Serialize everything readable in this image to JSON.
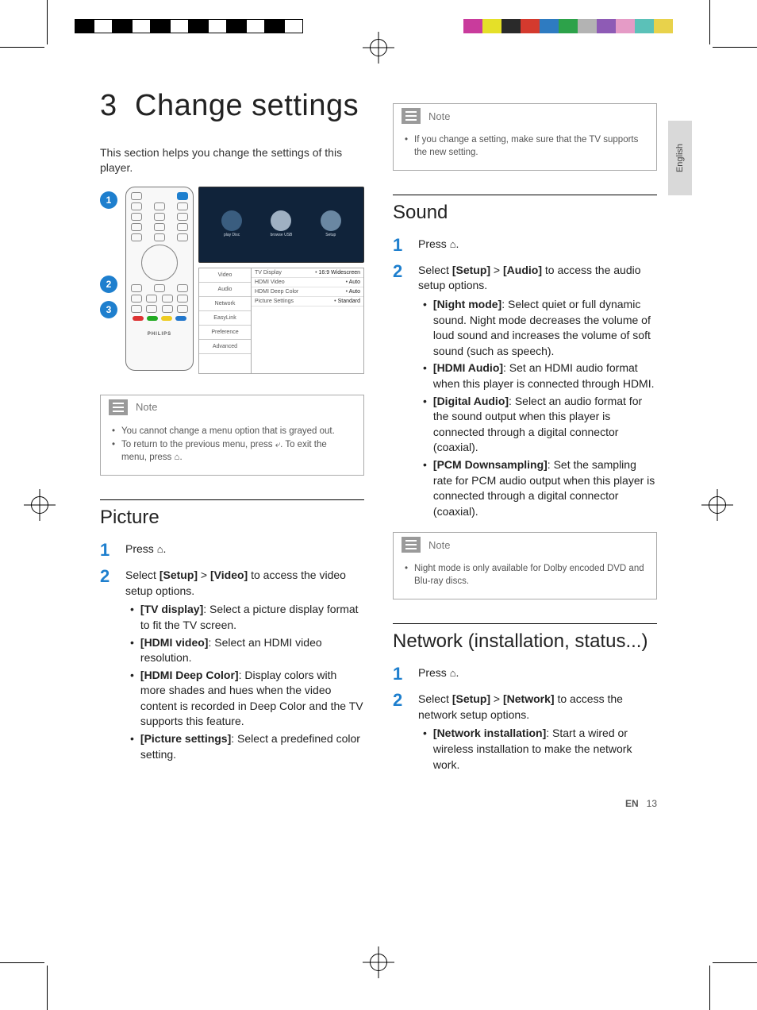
{
  "lang_tab": "English",
  "chapter_number": "3",
  "chapter_title": "Change settings",
  "intro": "This section helps you change the settings of this player.",
  "callouts": [
    "1",
    "2",
    "3"
  ],
  "remote_brand": "PHILIPS",
  "tv_items": [
    "play Disc",
    "browse USB",
    "Setup"
  ],
  "settings_menu": [
    "Video",
    "Audio",
    "Network",
    "EasyLink",
    "Preference",
    "Advanced"
  ],
  "settings_rows": [
    {
      "k": "TV Display",
      "v": "16:9 Widescreen"
    },
    {
      "k": "HDMI Video",
      "v": "Auto"
    },
    {
      "k": "HDMI Deep Color",
      "v": "Auto"
    },
    {
      "k": "Picture Settings",
      "v": "Standard"
    }
  ],
  "note_label": "Note",
  "note1_items": [
    "You cannot change a menu option that is grayed out.",
    "To return to the previous menu, press ⤶. To exit the menu, press ⌂."
  ],
  "picture": {
    "heading": "Picture",
    "step1": "Press ",
    "step2_a": "Select ",
    "step2_setup": "[Setup]",
    "step2_gt": " > ",
    "step2_video": "[Video]",
    "step2_b": " to access the video setup options.",
    "opts": [
      {
        "k": "[TV display]",
        "v": ": Select a picture display format to fit the TV screen."
      },
      {
        "k": "[HDMI video]",
        "v": ": Select an HDMI video resolution."
      },
      {
        "k": "[HDMI Deep Color]",
        "v": ": Display colors with more shades and hues when the video content is recorded in Deep Color and the TV supports this feature."
      },
      {
        "k": "[Picture settings]",
        "v": ": Select a predefined color setting."
      }
    ]
  },
  "note2_items": [
    "If you change a setting, make sure that the TV supports the new setting."
  ],
  "sound": {
    "heading": "Sound",
    "step1": "Press ",
    "step2_a": "Select ",
    "step2_setup": "[Setup]",
    "step2_gt": " > ",
    "step2_audio": "[Audio]",
    "step2_b": " to access the audio setup options.",
    "opts": [
      {
        "k": "[Night mode]",
        "v": ": Select quiet or full dynamic sound. Night mode decreases the volume of loud sound and increases the volume of soft sound (such as speech)."
      },
      {
        "k": "[HDMI Audio]",
        "v": ": Set an HDMI audio format when this player is connected through HDMI."
      },
      {
        "k": "[Digital Audio]",
        "v": ": Select an audio format for the sound output when this player is connected through a digital connector (coaxial)."
      },
      {
        "k": "[PCM Downsampling]",
        "v": ": Set the sampling rate for PCM audio output when this player is connected through a digital connector (coaxial)."
      }
    ]
  },
  "note3_items": [
    "Night mode is only available for Dolby encoded DVD and Blu-ray discs."
  ],
  "network": {
    "heading": "Network (installation, status...)",
    "step1": "Press ",
    "step2_a": "Select ",
    "step2_setup": "[Setup]",
    "step2_gt": " > ",
    "step2_net": "[Network]",
    "step2_b": " to access the network setup options.",
    "opts": [
      {
        "k": "[Network installation]",
        "v": ": Start a wired or wireless installation to make the network work."
      }
    ]
  },
  "footer_lang": "EN",
  "footer_page": "13",
  "reg_bw": [
    "#000",
    "#fff",
    "#000",
    "#fff",
    "#000",
    "#fff",
    "#000",
    "#fff",
    "#000",
    "#fff",
    "#000",
    "#fff"
  ],
  "reg_color": [
    "#fff",
    "#c93b9c",
    "#e5e028",
    "#2a2a2a",
    "#d43a2e",
    "#2e7bc1",
    "#2da24a",
    "#b3b3b3",
    "#8e5bb5",
    "#e59bc6",
    "#5bc1b8",
    "#e8d24b"
  ]
}
